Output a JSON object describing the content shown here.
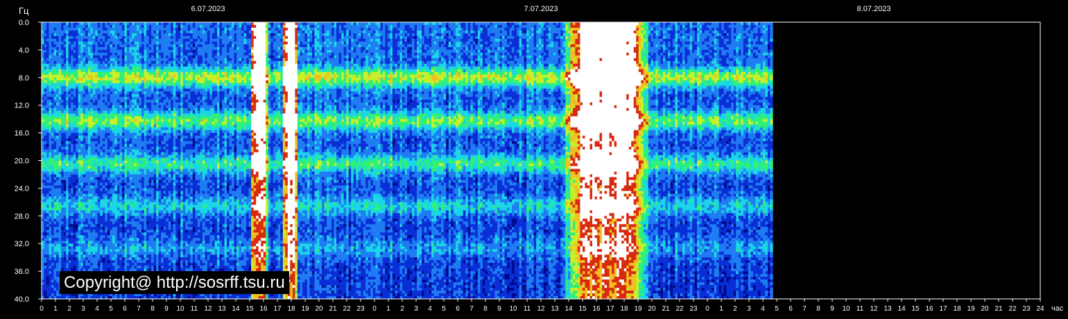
{
  "chart_data": {
    "type": "heatmap",
    "title": "",
    "ylabel": "Гц",
    "xlabel": "час",
    "ylim": [
      0,
      40
    ],
    "y_ticks": [
      "0.0",
      "4.0",
      "8.0",
      "12.0",
      "16.0",
      "20.0",
      "24.0",
      "28.0",
      "32.0",
      "36.0",
      "40.0"
    ],
    "x_ticks": [
      "0",
      "1",
      "2",
      "3",
      "4",
      "5",
      "6",
      "7",
      "8",
      "9",
      "10",
      "11",
      "12",
      "13",
      "14",
      "15",
      "16",
      "17",
      "18",
      "19",
      "20",
      "21",
      "22",
      "23",
      "0",
      "1",
      "2",
      "3",
      "4",
      "5",
      "6",
      "7",
      "8",
      "9",
      "10",
      "11",
      "12",
      "13",
      "14",
      "15",
      "16",
      "17",
      "18",
      "19",
      "20",
      "21",
      "22",
      "23",
      "0",
      "1",
      "2",
      "3",
      "4",
      "5",
      "6",
      "7",
      "8",
      "9",
      "10",
      "11",
      "12",
      "13",
      "14",
      "15",
      "16",
      "17",
      "18",
      "19",
      "20",
      "21",
      "22",
      "23",
      "24"
    ],
    "dates": [
      {
        "label": "6.07.2023",
        "at_hour": 12
      },
      {
        "label": "7.07.2023",
        "at_hour": 36
      },
      {
        "label": "8.07.2023",
        "at_hour": 60
      }
    ],
    "data_end_hour": 52.7,
    "bright_bands_hz": [
      7.8,
      14.1,
      20.3,
      26.4,
      32.5
    ],
    "noise_bursts": [
      {
        "start_hour": 15.1,
        "end_hour": 16.1
      },
      {
        "start_hour": 17.4,
        "end_hour": 18.3
      },
      {
        "start_hour": 37.7,
        "end_hour": 43.6
      }
    ],
    "colorscale": [
      "#000a8c",
      "#0a2fd6",
      "#1f7cf2",
      "#1ad6e6",
      "#2ff07a",
      "#c8f02a",
      "#f0c020",
      "#d82a10",
      "#ffffff"
    ]
  },
  "watermark": "Copyright@ http://sosrff.tsu.ru"
}
